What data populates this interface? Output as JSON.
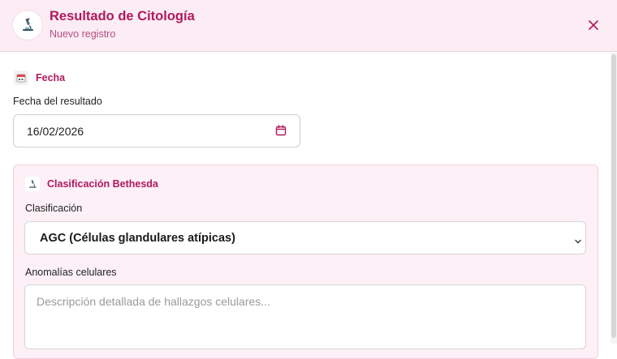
{
  "header": {
    "title": "Resultado de Citología",
    "subtitle": "Nuevo registro",
    "icon": "microscope-icon",
    "close_icon": "close-icon"
  },
  "fecha_section": {
    "title": "Fecha",
    "icon": "calendar-icon",
    "date_label": "Fecha del resultado",
    "date_value": "16/02/2026"
  },
  "bethesda_section": {
    "title": "Clasificación Bethesda",
    "icon": "microscope-icon",
    "classification_label": "Clasificación",
    "classification_value": "AGC (Células glandulares atípicas)",
    "anomalies_label": "Anomalías celulares",
    "anomalies_placeholder": "Descripción detallada de hallazgos celulares..."
  },
  "colors": {
    "accent": "#b0185f",
    "header_bg": "#fcecf4",
    "panel_bg": "#fdf0f6"
  }
}
